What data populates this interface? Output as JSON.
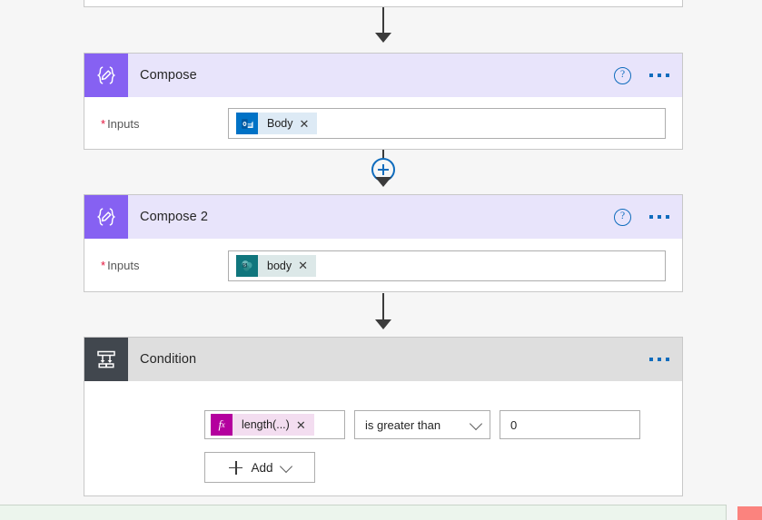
{
  "app": {
    "name": "Power Automate flow designer",
    "canvas_bg": "#f6f6f6"
  },
  "colors": {
    "compose_icon": "#8661f2",
    "compose_header": "#e8e4fb",
    "condition_icon": "#41474e",
    "condition_header": "#dedede",
    "accent_blue": "#0f6cbd",
    "required_red": "#e3143c",
    "outlook_blue": "#0072c6",
    "sharepoint_teal": "#10767d",
    "fx_magenta": "#b4009e",
    "fx_token_bg": "#f3ddf0",
    "token_bg": "#ddeaf5",
    "bottom_green": "#ecf5ed",
    "bottom_red": "#fb837e"
  },
  "nodes": [
    {
      "id": "compose",
      "title": "Compose",
      "icon": "compose-braces-pencil-icon",
      "help_icon": "help-question-icon",
      "menu_icon": "more-ellipsis-icon",
      "field": {
        "label": "Inputs",
        "required": true,
        "required_marker": "*",
        "token": {
          "text": "Body",
          "icon": "outlook-icon",
          "remove_icon": "✕"
        }
      }
    },
    {
      "id": "compose-2",
      "title": "Compose 2",
      "icon": "compose-braces-pencil-icon",
      "help_icon": "help-question-icon",
      "menu_icon": "more-ellipsis-icon",
      "field": {
        "label": "Inputs",
        "required": true,
        "required_marker": "*",
        "token": {
          "text": "body",
          "icon": "sharepoint-icon",
          "remove_icon": "✕"
        }
      }
    },
    {
      "id": "condition",
      "title": "Condition",
      "icon": "condition-branch-icon",
      "menu_icon": "more-ellipsis-icon",
      "row": {
        "expression_token": {
          "text": "length(...)",
          "icon": "fx-icon",
          "icon_label": "fx",
          "remove_icon": "✕"
        },
        "operator": "is greater than",
        "operator_chevron": "chevron-down-icon",
        "value": "0"
      },
      "add_button": {
        "label": "Add",
        "plus_icon": "plus-icon",
        "chevron_icon": "chevron-down-icon"
      }
    }
  ],
  "connectors": {
    "insert_button_label": "+",
    "insert_button_icon": "plus-circle-icon"
  }
}
